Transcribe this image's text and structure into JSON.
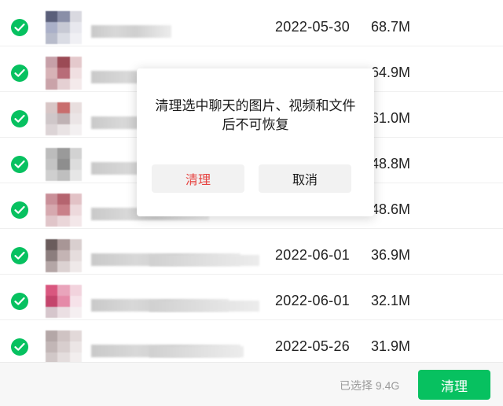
{
  "files": [
    {
      "date": "2022-05-30",
      "size": "68.7M",
      "thumb": [
        "#5a5f7a",
        "#8a8fa8",
        "#d9d9e0",
        "#aab0c8",
        "#c7c9d4",
        "#e8e8ee",
        "#b8bccb",
        "#dadce4",
        "#f0f0f4"
      ]
    },
    {
      "date": "",
      "size": "64.9M",
      "thumb": [
        "#c7a0a8",
        "#9b4a55",
        "#e4c9cc",
        "#d7b2b6",
        "#b86c78",
        "#f0dfe1",
        "#caa3a9",
        "#e5d0d3",
        "#f4eaeb"
      ]
    },
    {
      "date": "",
      "size": "61.0M",
      "thumb": [
        "#d8c6c6",
        "#c96d6d",
        "#e8dede",
        "#cfc7c9",
        "#bfb2b4",
        "#ebe5e6",
        "#dcd4d6",
        "#e9e3e4",
        "#f3f0f1"
      ]
    },
    {
      "date": "",
      "size": "48.8M",
      "thumb": [
        "#bcbcbc",
        "#9a9a9a",
        "#d2d2d2",
        "#c4c4c4",
        "#8e8e8e",
        "#dddddd",
        "#cfcfcf",
        "#bfbfbf",
        "#e6e6e6"
      ]
    },
    {
      "date": "",
      "size": "48.6M",
      "thumb": [
        "#c98f98",
        "#b5646f",
        "#e2c2c6",
        "#d6a9af",
        "#c98089",
        "#edd9dc",
        "#e0c5c9",
        "#ead6d9",
        "#f3e7e9"
      ]
    },
    {
      "date": "2022-06-01",
      "size": "36.9M",
      "thumb": [
        "#6a5c5c",
        "#a89696",
        "#d9cfcf",
        "#8c7e7e",
        "#c4b4b4",
        "#e6dddd",
        "#b4a6a6",
        "#dcd2d2",
        "#efe9e9"
      ]
    },
    {
      "date": "2022-06-01",
      "size": "32.1M",
      "thumb": [
        "#d9577f",
        "#e9a4bb",
        "#f2d3dd",
        "#c4456c",
        "#e58aa8",
        "#f6e2e9",
        "#d6c6cc",
        "#ebdfe3",
        "#f5eff1"
      ]
    },
    {
      "date": "2022-05-26",
      "size": "31.9M",
      "thumb": [
        "#b4a7a7",
        "#cfc3c3",
        "#e2d9d9",
        "#c2b6b6",
        "#d8cece",
        "#ece6e6",
        "#d1c8c8",
        "#e4dddd",
        "#f2eeee"
      ]
    }
  ],
  "dialog": {
    "message_line1": "清理选中聊天的图片、视频和文件",
    "message_line2": "后不可恢复",
    "confirm_label": "清理",
    "cancel_label": "取消"
  },
  "footer": {
    "selected_text": "已选择 9.4G",
    "clean_label": "清理"
  },
  "colors": {
    "accent": "#07c160",
    "danger": "#e64340"
  }
}
